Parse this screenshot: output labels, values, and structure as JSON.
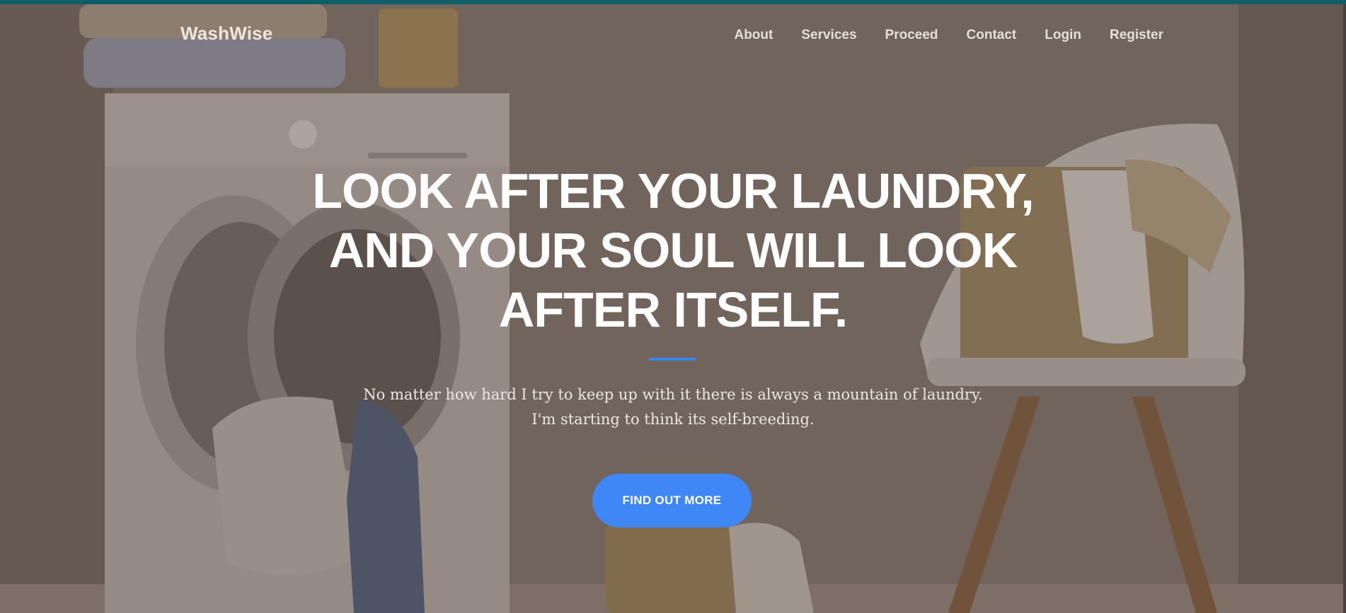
{
  "nav": {
    "brand": "WashWise",
    "items": [
      {
        "label": "About"
      },
      {
        "label": "Services"
      },
      {
        "label": "Proceed"
      },
      {
        "label": "Contact"
      },
      {
        "label": "Login"
      },
      {
        "label": "Register"
      }
    ]
  },
  "hero": {
    "headline_lines": [
      "LOOK AFTER YOUR LAUNDRY,",
      "AND YOUR SOUL WILL LOOK",
      "AFTER ITSELF."
    ],
    "subtitle_lines": [
      "No matter how hard I try to keep up with it there is always a mountain of laundry.",
      "I'm starting to think its self-breeding."
    ],
    "cta_label": "FIND OUT MORE"
  },
  "colors": {
    "top_bar": "#0e5f68",
    "accent": "#3f86f6",
    "overlay": "#6f625a"
  }
}
